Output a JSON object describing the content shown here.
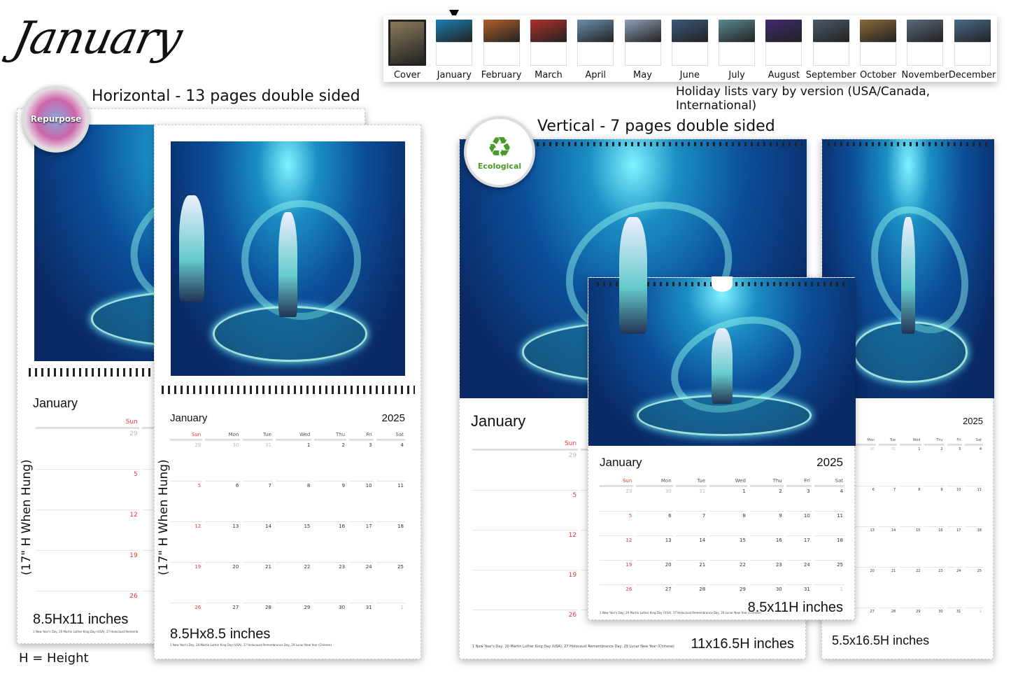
{
  "title_script": "January",
  "month_strip": {
    "selected": "January",
    "items": [
      {
        "label": "Cover"
      },
      {
        "label": "January"
      },
      {
        "label": "February"
      },
      {
        "label": "March"
      },
      {
        "label": "April"
      },
      {
        "label": "May"
      },
      {
        "label": "June"
      },
      {
        "label": "July"
      },
      {
        "label": "August"
      },
      {
        "label": "September"
      },
      {
        "label": "October"
      },
      {
        "label": "November"
      },
      {
        "label": "December"
      }
    ],
    "note": "Holiday lists vary by version (USA/Canada, International)"
  },
  "badges": {
    "repurpose": "Repurpose",
    "ecological": "Ecological"
  },
  "horizontal": {
    "heading": "Horizontal - 13 pages double sided",
    "hung_note": "(17\" H When Hung)",
    "height_note": "H = Height"
  },
  "vertical": {
    "heading": "Vertical - 7 pages double sided"
  },
  "calendar": {
    "month": "January",
    "year": "2025",
    "weekdays": [
      "Sun",
      "Mon",
      "Tue",
      "Wed",
      "Thu",
      "Fri",
      "Sat"
    ],
    "weeks": [
      [
        "29",
        "30",
        "31",
        "1",
        "2",
        "3",
        "4"
      ],
      [
        "5",
        "6",
        "7",
        "8",
        "9",
        "10",
        "11"
      ],
      [
        "12",
        "13",
        "14",
        "15",
        "16",
        "17",
        "18"
      ],
      [
        "19",
        "20",
        "21",
        "22",
        "23",
        "24",
        "25"
      ],
      [
        "26",
        "27",
        "28",
        "29",
        "30",
        "31",
        "1"
      ]
    ],
    "holidays": "1 New Year's Day, 20 Martin Luther King Day (USA), 27 Holocaust Remembrance Day, 29 Lunar New Year (Chinese)",
    "holidays_truncated": "1 New Year's Day, 20 Martin Luther King Day (USA), 27 Holocaust Rememb"
  },
  "sizes": {
    "h_8_5x11": "8.5Hx11 inches",
    "h_8_5x8_5": "8.5Hx8.5 inches",
    "v_11x16_5": "11x16.5H inches",
    "v_8_5x11": "8.5x11H inches",
    "v_5_5x16_5": "5.5x16.5H inches"
  },
  "colors": {
    "sunday": "#e33333",
    "recycle_green": "#4a9a2a"
  }
}
